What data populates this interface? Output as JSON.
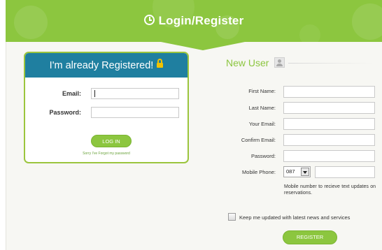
{
  "header": {
    "title": "Login/Register",
    "icon": "clock-icon",
    "color": "#8cc63f"
  },
  "login": {
    "heading": "I'm already Registered!",
    "heading_bg": "#1f7fa0",
    "icon": "lock-icon",
    "email_label": "Email:",
    "email_value": "",
    "password_label": "Password:",
    "password_value": "",
    "login_button": "LOG IN",
    "forgot_link": "Sorry I've Forgot my password"
  },
  "register": {
    "heading": "New User",
    "icon": "user-card-icon",
    "fields": {
      "first_name": "First Name:",
      "last_name": "Last Name:",
      "your_email": "Your Email:",
      "confirm_email": "Confirm Email:",
      "password": "Password:",
      "mobile_phone": "Mobile Phone:"
    },
    "phone_prefix": "087",
    "mobile_note": "Mobile number to recieve text updates on reservations.",
    "newsletter_label": "Keep me updated with latest news and services",
    "newsletter_checked": false,
    "register_button": "REGISTER"
  }
}
